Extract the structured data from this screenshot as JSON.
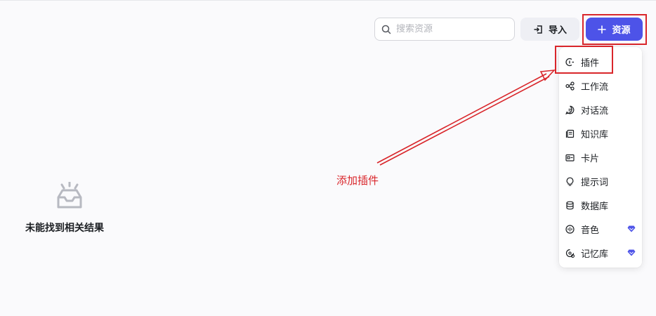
{
  "search": {
    "placeholder": "搜索资源",
    "value": ""
  },
  "toolbar": {
    "import_label": "导入",
    "resource_label": "资源"
  },
  "menu": {
    "items": [
      {
        "label": "插件",
        "icon": "plugin-icon"
      },
      {
        "label": "工作流",
        "icon": "workflow-icon"
      },
      {
        "label": "对话流",
        "icon": "chatflow-icon"
      },
      {
        "label": "知识库",
        "icon": "knowledge-icon"
      },
      {
        "label": "卡片",
        "icon": "card-icon"
      },
      {
        "label": "提示词",
        "icon": "prompt-icon"
      },
      {
        "label": "数据库",
        "icon": "database-icon"
      },
      {
        "label": "音色",
        "icon": "voice-icon",
        "premium": true
      },
      {
        "label": "记忆库",
        "icon": "memory-icon",
        "premium": true
      }
    ]
  },
  "annotation": {
    "text": "添加插件"
  },
  "empty_state": {
    "text": "未能找到相关结果",
    "icon": "empty-inbox-icon"
  },
  "colors": {
    "accent": "#4d53e8",
    "annotation": "#d9262b",
    "premium": "#4d53e8"
  }
}
